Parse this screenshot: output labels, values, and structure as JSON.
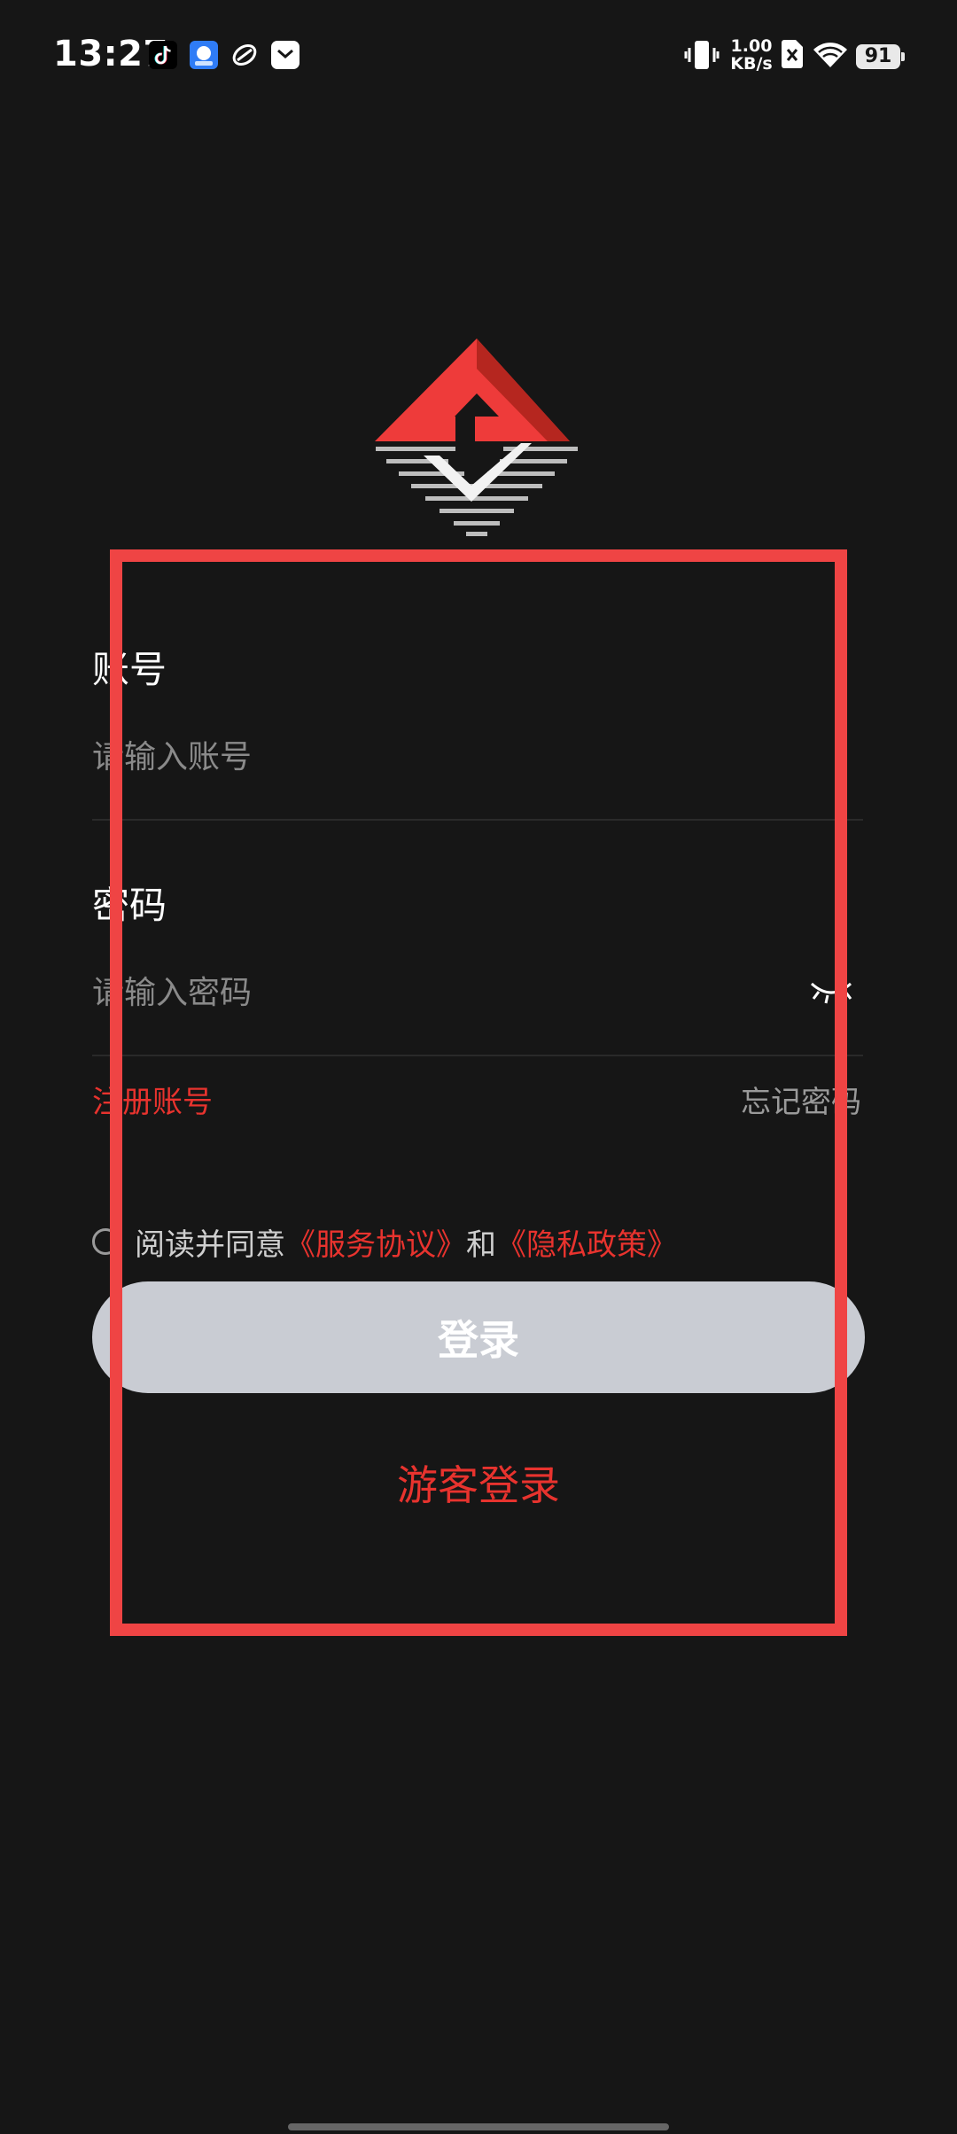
{
  "status_bar": {
    "time": "13:27",
    "net_speed_value": "1.00",
    "net_speed_unit": "KB/s",
    "battery": "91",
    "icons": [
      "tiktok-icon",
      "app-badge-icon",
      "sync-app-icon",
      "message-app-icon",
      "vibrate-icon",
      "no-sim-icon",
      "wifi-icon",
      "battery-icon"
    ]
  },
  "logo": {
    "icon": "brand-logo-icon",
    "colors": {
      "red": "#ee3b3a",
      "silver": "#bdbdbd"
    }
  },
  "form": {
    "account_label": "账号",
    "account_placeholder": "请输入账号",
    "password_label": "密码",
    "password_placeholder": "请输入密码",
    "register": "注册账号",
    "forgot": "忘记密码"
  },
  "agreement": {
    "prefix": "阅读并同意",
    "terms": "《服务协议》",
    "and": "和",
    "privacy": "《隐私政策》"
  },
  "buttons": {
    "login": "登录",
    "guest_login": "游客登录"
  },
  "colors": {
    "background": "#161616",
    "accent_red": "#e8332e",
    "login_button_bg": "#c9ccd3",
    "annotation": "#ef4444"
  }
}
